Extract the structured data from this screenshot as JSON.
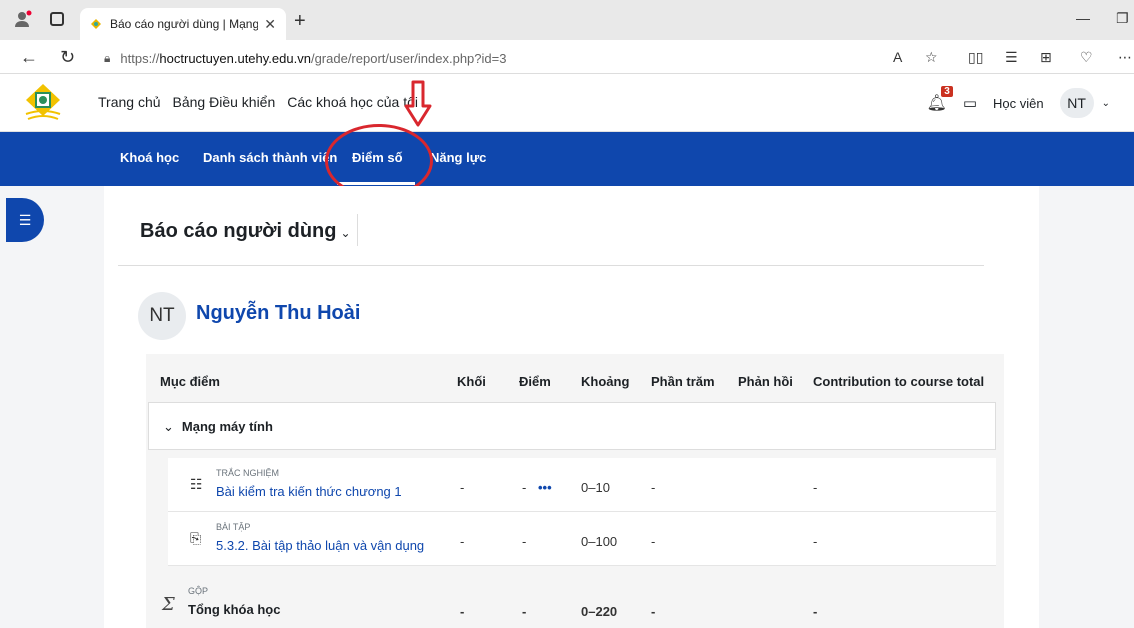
{
  "browser": {
    "tab_title": "Báo cáo người dùng | Mạng máy",
    "url_prefix": "https://",
    "url_host": "hoctructuyen.utehy.edu.vn",
    "url_path": "/grade/report/user/index.php?id=3"
  },
  "header": {
    "nav": [
      "Trang chủ",
      "Bảng Điều khiển",
      "Các khoá học của tôi"
    ],
    "notification_count": "3",
    "user_role": "Học viên",
    "user_initials": "NT"
  },
  "secondary_nav": {
    "items": [
      "Khoá học",
      "Danh sách thành viên",
      "Điểm số",
      "Năng lực"
    ],
    "active": "Điểm số"
  },
  "report": {
    "title": "Báo cáo người dùng",
    "user_initials": "NT",
    "user_name": "Nguyễn Thu Hoài"
  },
  "table": {
    "headers": [
      "Mục điểm",
      "Khối",
      "Điểm",
      "Khoảng",
      "Phần trăm",
      "Phản hồi",
      "Contribution to course total"
    ],
    "category": "Mạng máy tính",
    "rows": [
      {
        "type": "TRẮC NGHIỆM",
        "name": "Bài kiểm tra kiến thức chương 1",
        "block": "-",
        "grade": "-",
        "range": "0–10",
        "percent": "-",
        "contribution": "-",
        "icon": "quiz-icon"
      },
      {
        "type": "BÀI TẬP",
        "name": "5.3.2. Bài tập thảo luận và vận dụng",
        "block": "-",
        "grade": "-",
        "range": "0–100",
        "percent": "-",
        "contribution": "-",
        "icon": "assignment-icon"
      }
    ],
    "total": {
      "type": "GỘP",
      "name": "Tổng khóa học",
      "block": "-",
      "grade": "-",
      "range": "0–220",
      "percent": "-",
      "contribution": "-"
    }
  },
  "colors": {
    "primary": "#0f47ad",
    "annotation": "#d9272e"
  }
}
